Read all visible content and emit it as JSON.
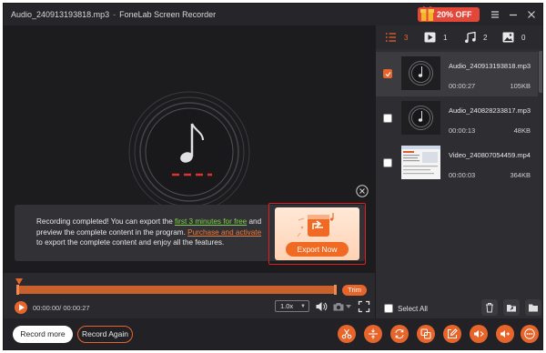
{
  "window": {
    "file_name": "Audio_240913193818.mp3",
    "app_name": "FoneLab Screen Recorder",
    "separator": "-",
    "promo_label": "20% OFF"
  },
  "notice": {
    "text_1": "Recording completed! You can export the ",
    "link_free": "first 3 minutes for free",
    "text_2": " and preview the complete content in the program. ",
    "link_purchase": "Purchase and activate",
    "text_3": " to export the complete content and enjoy all the features.",
    "export_label": "Export Now"
  },
  "player": {
    "trim_label": "Trim",
    "timecode": "00:00:00/ 00:00:27",
    "speed": "1.0x"
  },
  "bottom": {
    "record_more": "Record more",
    "record_again": "Record Again"
  },
  "tabs": [
    {
      "icon": "list-icon",
      "count": "3"
    },
    {
      "icon": "video-icon",
      "count": "1"
    },
    {
      "icon": "music-icon",
      "count": "2"
    },
    {
      "icon": "image-icon",
      "count": "0"
    }
  ],
  "recordings": [
    {
      "name": "Audio_240913193818.mp3",
      "duration": "00:00:27",
      "size": "105KB",
      "checked": true
    },
    {
      "name": "Audio_240828233817.mp3",
      "duration": "00:00:13",
      "size": "48KB",
      "checked": false
    },
    {
      "name": "Video_240807054459.mp4",
      "duration": "00:00:03",
      "size": "364KB",
      "checked": false
    }
  ],
  "select_all_label": "Select All",
  "colors": {
    "accent": "#e7652a",
    "background": "#2a2a2e",
    "preview_bg": "#1c1c1f",
    "link_green": "#7ed14a",
    "promo_red": "#e2473a"
  }
}
